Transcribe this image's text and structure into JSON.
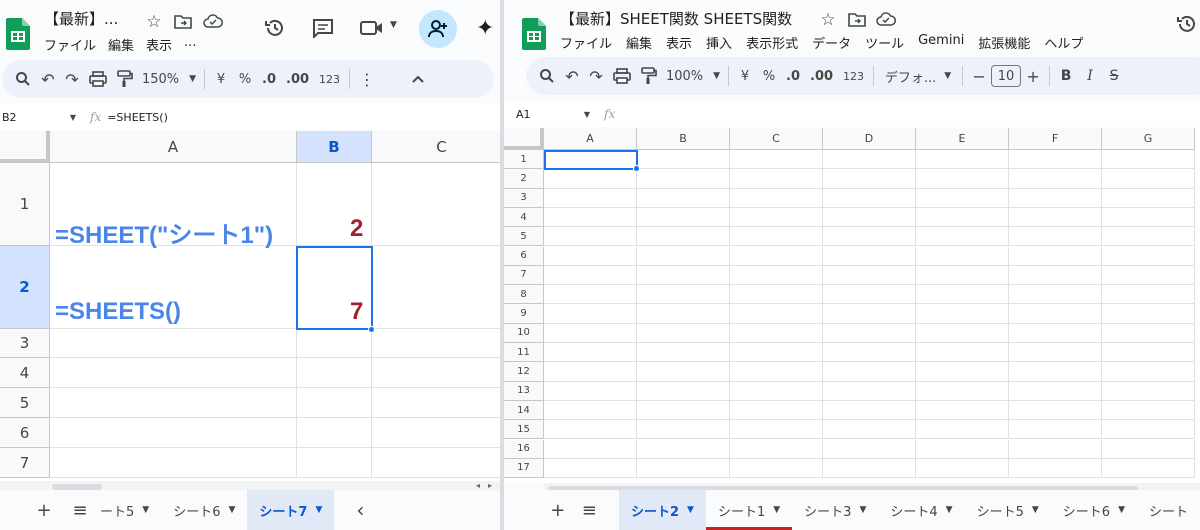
{
  "left_window": {
    "title": "【最新】...",
    "menu": [
      "ファイル",
      "編集",
      "表示",
      "..."
    ],
    "toolbar": {
      "zoom": "150%",
      "currency": "¥",
      "percent": "%",
      "dec_minus": ".0",
      "dec_plus": ".00",
      "number_format": "123"
    },
    "formula_bar": {
      "name_box": "B2",
      "fx": "fx",
      "formula": "=SHEETS()"
    },
    "columns": [
      "A",
      "B",
      "C"
    ],
    "rows": [
      "1",
      "2",
      "3",
      "4",
      "5",
      "6",
      "7"
    ],
    "cells": {
      "A1": "=SHEET(\"シート1\")",
      "B1": "2",
      "A2": "=SHEETS()",
      "B2": "7"
    },
    "tabs": [
      {
        "label": "ート5",
        "active": false
      },
      {
        "label": "シート6",
        "active": false
      },
      {
        "label": "シート7",
        "active": true
      }
    ],
    "tab_nav_prev": "‹"
  },
  "right_window": {
    "title": "【最新】SHEET関数 SHEETS関数",
    "menu": [
      "ファイル",
      "編集",
      "表示",
      "挿入",
      "表示形式",
      "データ",
      "ツール",
      "Gemini",
      "拡張機能",
      "ヘルプ"
    ],
    "toolbar": {
      "zoom": "100%",
      "currency": "¥",
      "percent": "%",
      "dec_minus": ".0",
      "dec_plus": ".00",
      "number_format": "123",
      "font": "デフォ...",
      "font_size": "10",
      "minus": "−",
      "plus": "+",
      "bold": "B",
      "italic": "I",
      "strike": "S"
    },
    "formula_bar": {
      "name_box": "A1",
      "fx": "fx",
      "formula": ""
    },
    "columns": [
      "A",
      "B",
      "C",
      "D",
      "E",
      "F",
      "G"
    ],
    "rows": [
      "1",
      "2",
      "3",
      "4",
      "5",
      "6",
      "7",
      "8",
      "9",
      "10",
      "11",
      "12",
      "13",
      "14",
      "15",
      "16",
      "17"
    ],
    "tabs": [
      {
        "label": "シート2",
        "active": true,
        "color": ""
      },
      {
        "label": "シート1",
        "active": false,
        "color": "#c5221f"
      },
      {
        "label": "シート3",
        "active": false,
        "color": ""
      },
      {
        "label": "シート4",
        "active": false,
        "color": ""
      },
      {
        "label": "シート5",
        "active": false,
        "color": ""
      },
      {
        "label": "シート6",
        "active": false,
        "color": ""
      },
      {
        "label": "シート",
        "active": false,
        "color": ""
      }
    ]
  },
  "colors": {
    "selection": "#1a73e8",
    "formula_text": "#4a86e8",
    "number_text": "#a3202f",
    "header_selected": "#d3e3fd",
    "sheets_green": "#0f9d58",
    "share_button": "#c2e7ff"
  }
}
